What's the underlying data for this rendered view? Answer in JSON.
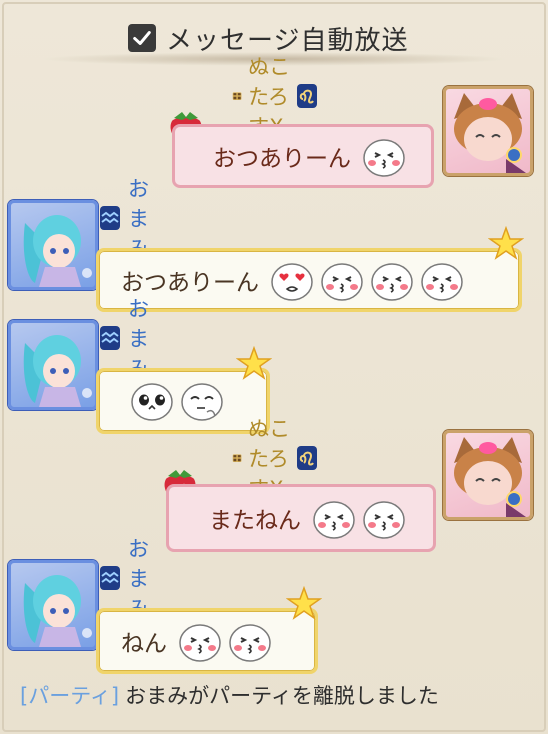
{
  "header": {
    "auto_broadcast_label": "メッセージ自動放送",
    "auto_broadcast_checked": true
  },
  "messages": [
    {
      "sender": "ぬこたろすX",
      "side": "right",
      "style": "pink",
      "text": "おつありーん",
      "emojis": [
        "kiss-face-emoji"
      ],
      "zodiac": "leo"
    },
    {
      "sender": "おまみ",
      "side": "left",
      "style": "yellow",
      "text": "おつありーん",
      "emojis": [
        "heart-eyes-face-emoji",
        "kiss-face-emoji",
        "kiss-face-emoji",
        "kiss-face-emoji"
      ],
      "zodiac": "aquarius"
    },
    {
      "sender": "おまみ",
      "side": "left",
      "style": "yellow",
      "text": "",
      "emojis": [
        "teary-eyes-face-emoji",
        "thinking-face-emoji"
      ],
      "zodiac": "aquarius"
    },
    {
      "sender": "ぬこたろすX",
      "side": "right",
      "style": "pink",
      "text": "またねん",
      "emojis": [
        "kiss-face-emoji",
        "kiss-face-emoji"
      ],
      "zodiac": "leo"
    },
    {
      "sender": "おまみ",
      "side": "left",
      "style": "yellow",
      "text": "ねん",
      "emojis": [
        "kiss-face-emoji",
        "kiss-face-emoji"
      ],
      "zodiac": "aquarius"
    }
  ],
  "system": {
    "tag": "[パーティ]",
    "text": "おまみがパーティを離脱しました"
  },
  "colors": {
    "sender_gold": "#b08b2a",
    "sender_blue": "#3a6fc4",
    "system_tag": "#6aa0df",
    "bubble_yellow_border": "#f0d46a",
    "bubble_pink_border": "#e7a3b0"
  }
}
